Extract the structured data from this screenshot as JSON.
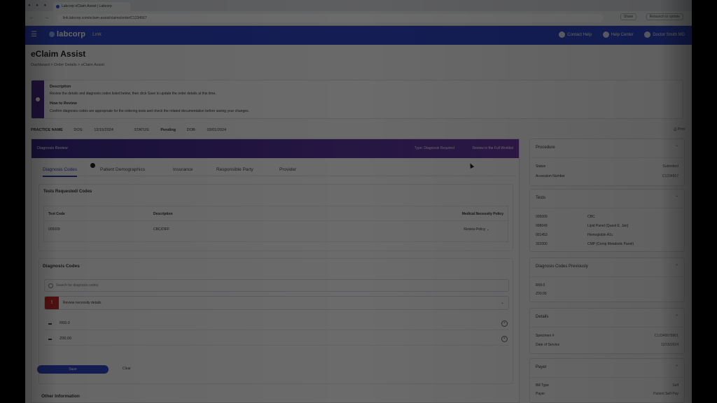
{
  "browser": {
    "tab_title": "Labcorp eClaim Assist | Labcorp",
    "window_controls": "● ● ●",
    "nav_icons": "← → ⟳",
    "url": "link.labcorp.com/eclaim-assist/claims/order/C1234567",
    "action_1": "Share",
    "action_2": "Relaunch to update"
  },
  "header": {
    "brand": "labcorp",
    "product": "Link",
    "menu_icon": "☰",
    "items": [
      "Contact Help",
      "Help Center",
      "Doctor Smith MD"
    ]
  },
  "page": {
    "title": "eClaim Assist",
    "breadcrumb": "Dashboard  >  Order Details  >  eClaim Assist"
  },
  "notice": {
    "title1": "Description",
    "text1": "Review the details and diagnosis codes listed below, then click Save to update the order details at this time.",
    "title2": "How to Review",
    "text2": "Confirm diagnosis codes are appropriate for the ordering tests and check the related documentation before saving your changes."
  },
  "meta": {
    "items": [
      {
        "label": "PRACTICE NAME",
        "value": ""
      },
      {
        "label": "DOS:",
        "value": "12/15/2024"
      },
      {
        "label": "STATUS:",
        "value": "Pending"
      },
      {
        "label": "DOB:",
        "value": "03/01/2024"
      }
    ],
    "print": "Print"
  },
  "panel": {
    "header_left": "Diagnosis Review",
    "header_right1": "Type: Diagnosis Required",
    "header_right2": "Review in the Full Worklist",
    "tabs": [
      "Diagnosis Codes",
      "Patient Demographics",
      "Insurance",
      "Responsible Party",
      "Provider"
    ]
  },
  "test_section": {
    "title": "Tests Requested/ Codes",
    "col_test": "Test Code",
    "col_desc": "Description",
    "col_policy": "Medical Necessity Policy",
    "row_code": "005009",
    "row_desc": "CBC/DIFF",
    "row_policy": "Review Policy  ⌄"
  },
  "diagnosis": {
    "title": "Diagnosis Codes",
    "search_placeholder": "Search for diagnosis codes",
    "warning_icon": "!",
    "warning_text": "Review necessity details",
    "warning_chevron": "⌄",
    "codes": [
      "R69.0",
      "Z00.00"
    ],
    "remove_glyph": "×",
    "save": "Save",
    "cancel": "Clear"
  },
  "other_info": "Other Information",
  "right": {
    "card1": {
      "title": "Procedure",
      "k1": "Status",
      "v1": "Submitted",
      "k2": "Accession Number",
      "v2": "C1234567"
    },
    "card2": {
      "title": "Tests",
      "rows": [
        {
          "k": "005009",
          "v": "CBC"
        },
        {
          "k": "008649",
          "v": "Lipid Panel (Quest E, Jan)"
        },
        {
          "k": "001453",
          "v": "Hemoglobin A1c"
        },
        {
          "k": "322000",
          "v": "CMP (Comp Metabolic Panel)"
        }
      ]
    },
    "card3": {
      "title": "Diagnosis Codes Previously",
      "k1": "R69.0",
      "k2": "Z00.00"
    },
    "card4": {
      "title": "Details",
      "k1": "Specimen #",
      "v1": "C12345678901",
      "k2": "Date of Service",
      "v2": "12/15/2024"
    },
    "card5": {
      "title": "Payer",
      "k1": "Bill Type",
      "v1": "Self",
      "k2": "Payer",
      "v2": "Patient Self-Pay"
    },
    "collapse": "⌃"
  }
}
